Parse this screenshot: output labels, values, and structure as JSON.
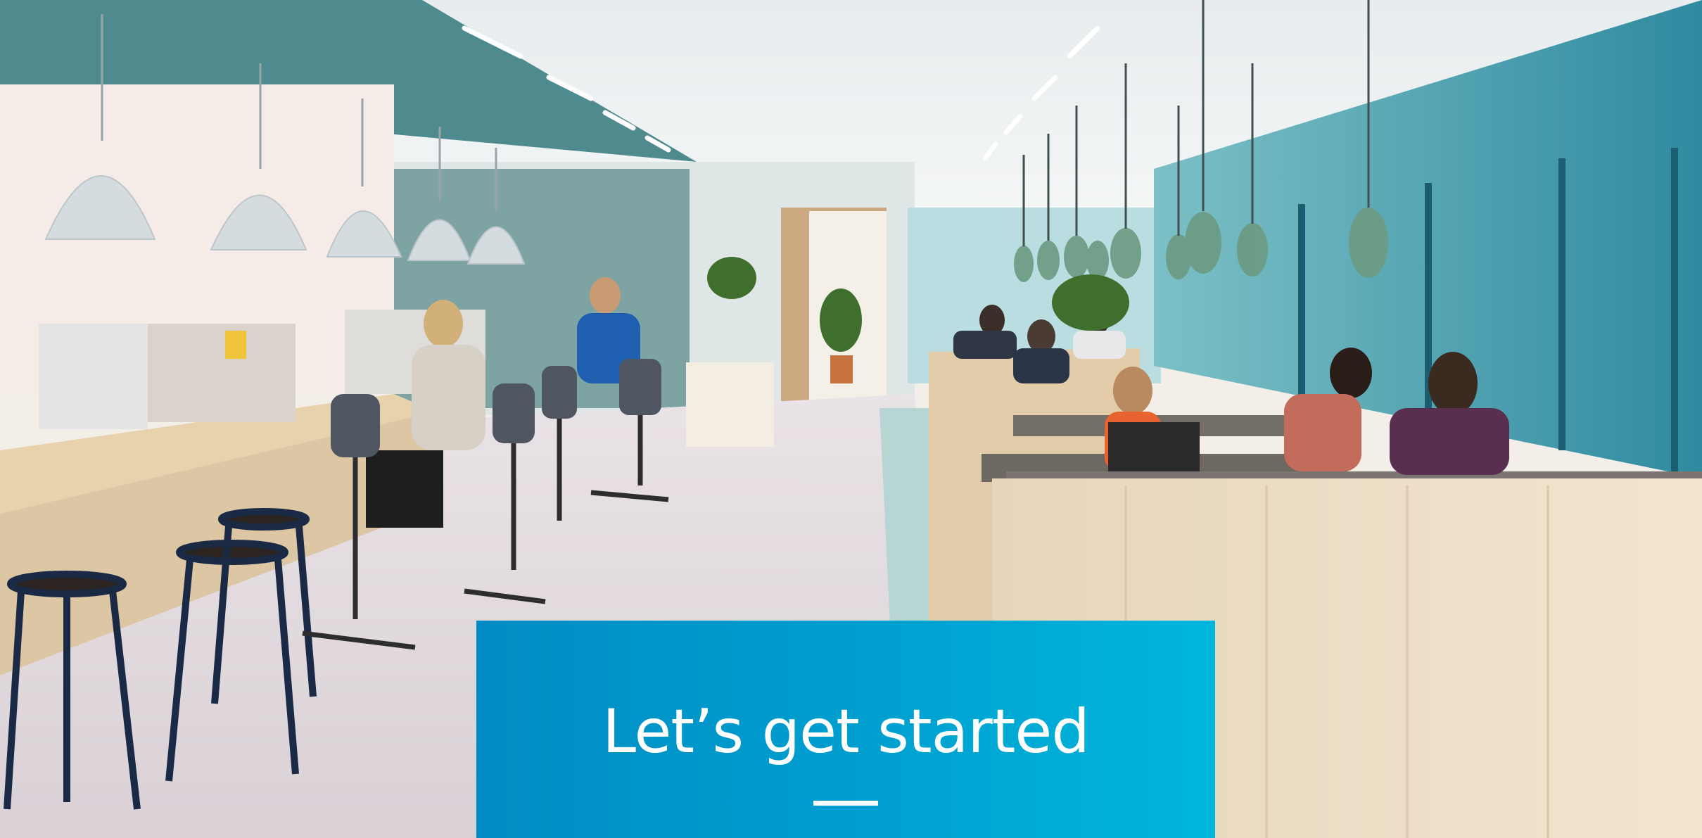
{
  "slide": {
    "title": "Let’s get started",
    "banner_color_start": "#008cc2",
    "banner_color_end": "#00b7dc",
    "title_color": "#ffffff"
  },
  "photo": {
    "subject": "office-interior-photo"
  }
}
